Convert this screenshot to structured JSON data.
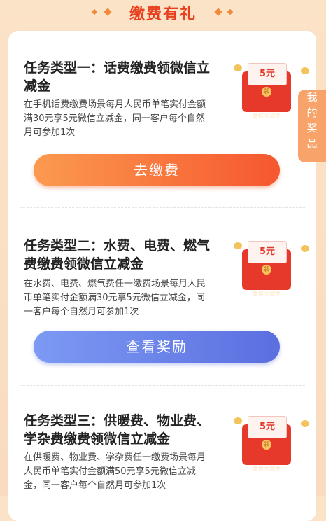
{
  "header": {
    "title": "缴费有礼"
  },
  "side_tab": {
    "label_chars": [
      "我",
      "的",
      "奖",
      "品"
    ]
  },
  "tasks": [
    {
      "title": "任务类型一：话费缴费领微信立减金",
      "desc": "在手机话费缴费场景每月人民币单笔实付金额满30元享5元微信立减金，同一客户每个自然月可参加1次",
      "reward": "5元",
      "envelope_label": "微信立减金",
      "seal": "领",
      "button": "去缴费"
    },
    {
      "title": "任务类型二：水费、电费、燃气费缴费领微信立减金",
      "desc": "在水费、电费、燃气费任一缴费场景每月人民币单笔实付金额满30元享5元微信立减金，同一客户每个自然月可参加1次",
      "reward": "5元",
      "envelope_label": "微信立减金",
      "seal": "领",
      "button": "查看奖励"
    },
    {
      "title": "任务类型三：供暖费、物业费、学杂费缴费领微信立减金",
      "desc": "在供暖费、物业费、学杂费任一缴费场景每月人民币单笔实付金额满50元享5元微信立减金，同一客户每个自然月可参加1次",
      "reward": "5元",
      "envelope_label": "微信立减金",
      "seal": "领"
    }
  ],
  "colors": {
    "accent": "#e8401f",
    "orange_button": "#f6572f",
    "blue_button": "#5b6fe0",
    "envelope": "#e6392b"
  }
}
